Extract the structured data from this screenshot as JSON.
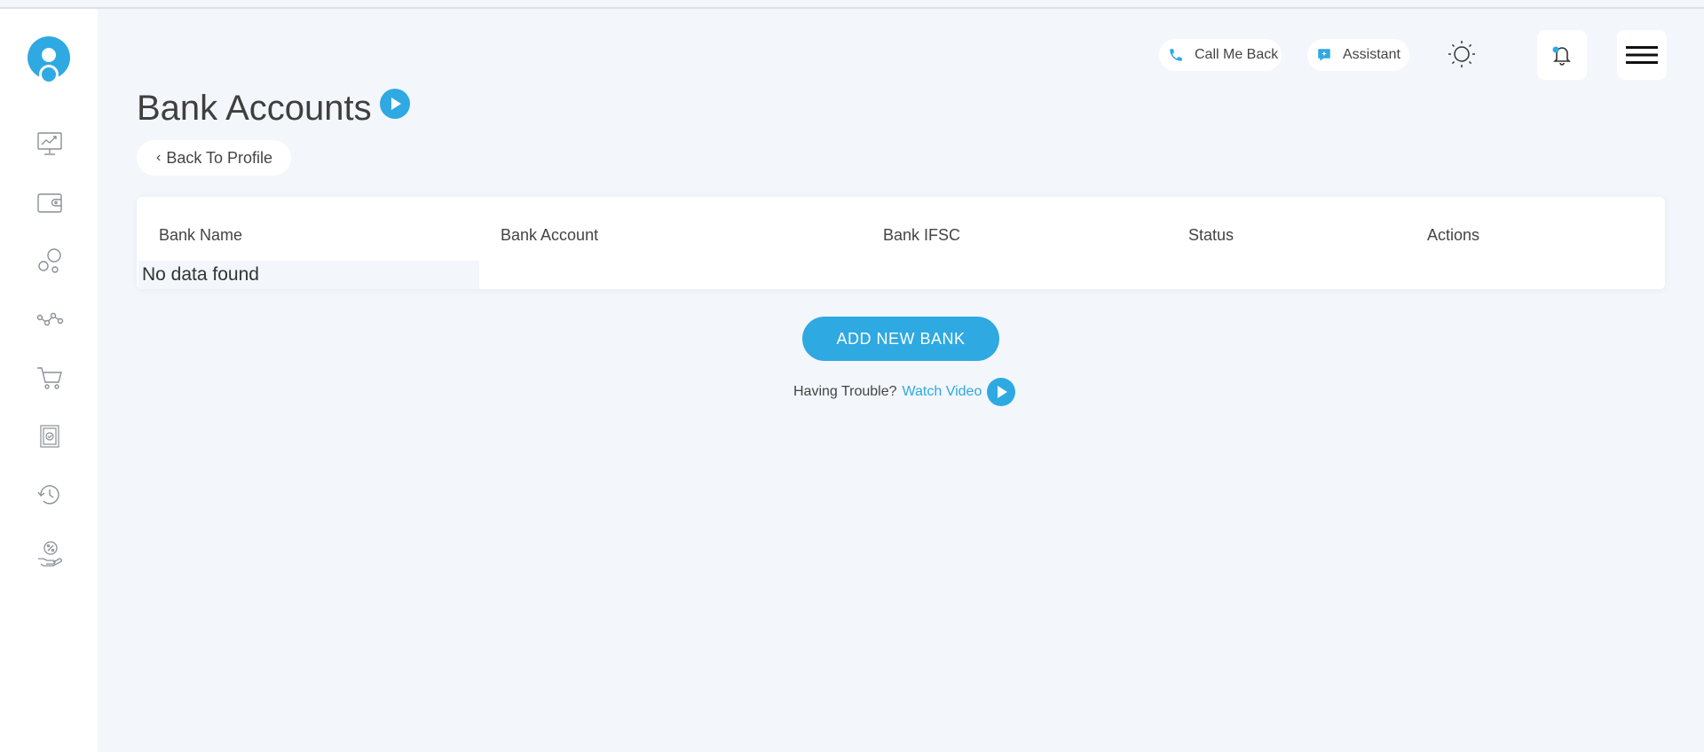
{
  "header": {
    "call_me_back": "Call Me Back",
    "assistant": "Assistant"
  },
  "page": {
    "title": "Bank Accounts",
    "back_label": "Back To Profile"
  },
  "table": {
    "columns": [
      "Bank Name",
      "Bank Account",
      "Bank IFSC",
      "Status",
      "Actions"
    ],
    "empty_message": "No data found"
  },
  "actions": {
    "add_bank": "ADD NEW BANK",
    "trouble_text": "Having Trouble?",
    "watch_video": "Watch Video"
  },
  "colors": {
    "accent": "#2ea9e2",
    "background": "#f3f6fb"
  },
  "sidebar": {
    "icons": [
      "dashboard-chart-icon",
      "wallet-icon",
      "bubbles-icon",
      "network-icon",
      "cart-icon",
      "certificate-icon",
      "history-icon",
      "offers-icon"
    ]
  }
}
